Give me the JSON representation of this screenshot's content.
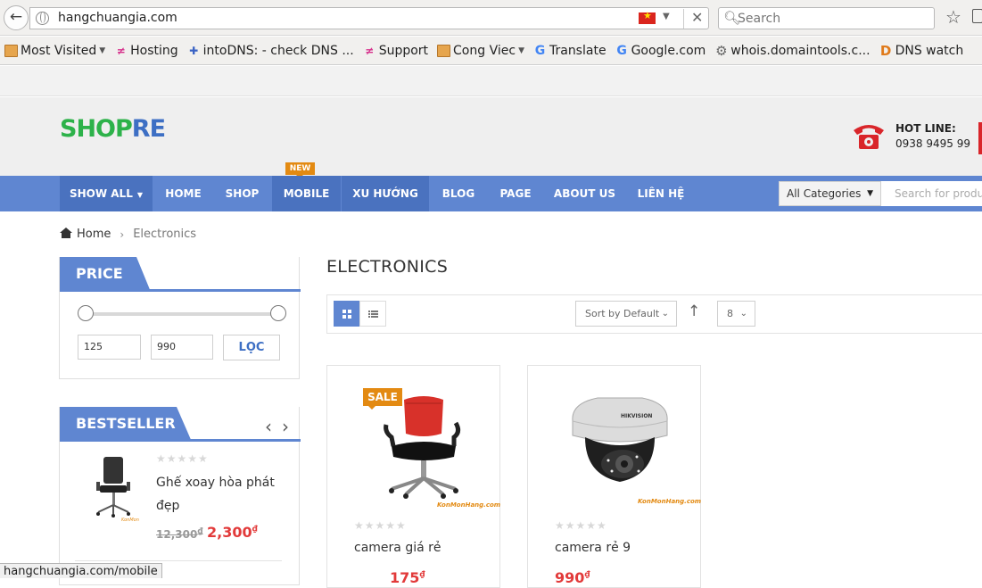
{
  "browser": {
    "url": "hangchuangia.com",
    "search_placeholder": "Search",
    "status_url": "hangchuangia.com/mobile",
    "bookmarks": [
      {
        "label": "Most Visited",
        "icon": "folder-icon"
      },
      {
        "label": "Hosting",
        "icon": "site-icon"
      },
      {
        "label": "intoDNS: - check DNS ...",
        "icon": "dns-icon"
      },
      {
        "label": "Support",
        "icon": "site-icon"
      },
      {
        "label": "Cong Viec",
        "icon": "folder-icon"
      },
      {
        "label": "Translate",
        "icon": "google-icon"
      },
      {
        "label": "Google.com",
        "icon": "google-icon"
      },
      {
        "label": "whois.domaintools.c...",
        "icon": "gear-icon"
      },
      {
        "label": "DNS watch",
        "icon": "d-icon"
      }
    ]
  },
  "header": {
    "logo_part1": "SHOP",
    "logo_part2": "RE",
    "hotline_label": "HOT LINE:",
    "hotline_number": "0938 9495 99"
  },
  "nav": {
    "items": [
      "SHOW ALL",
      "HOME",
      "SHOP",
      "MOBILE",
      "XU HƯỚNG",
      "BLOG",
      "PAGE",
      "ABOUT US",
      "LIÊN HỆ"
    ],
    "new_badge": "NEW",
    "category_select": "All Categories",
    "search_placeholder": "Search for produ"
  },
  "breadcrumb": {
    "home": "Home",
    "current": "Electronics"
  },
  "sidebar": {
    "price_title": "PRICE",
    "price_min": "125",
    "price_max": "990",
    "filter_button": "LỌC",
    "bestseller_title": "BESTSELLER",
    "bestseller_items": [
      {
        "name": "Ghế xoay hòa phát đẹp",
        "old_price": "12,300",
        "price": "2,300",
        "currency": "₫",
        "rating_stars": "★★★★★"
      }
    ]
  },
  "main": {
    "title": "ELECTRONICS",
    "sort_label": "Sort by Default",
    "per_page": "8",
    "sort_direction_icon": "↑",
    "products": [
      {
        "name": "camera giá rẻ",
        "badge": "SALE",
        "price_text": "175",
        "currency": "₫",
        "rating_stars": "★★★★★",
        "brand": "KonMonHang.com"
      },
      {
        "name": "camera rẻ 9",
        "price_text": "990",
        "currency": "₫",
        "rating_stars": "★★★★★",
        "brand": "KonMonHang.com"
      }
    ]
  },
  "colors": {
    "nav_blue": "#5f86d1",
    "nav_active": "#4a72bf",
    "accent_orange": "#e38a12",
    "price_red": "#e23a3a",
    "logo_green": "#2db24a"
  }
}
